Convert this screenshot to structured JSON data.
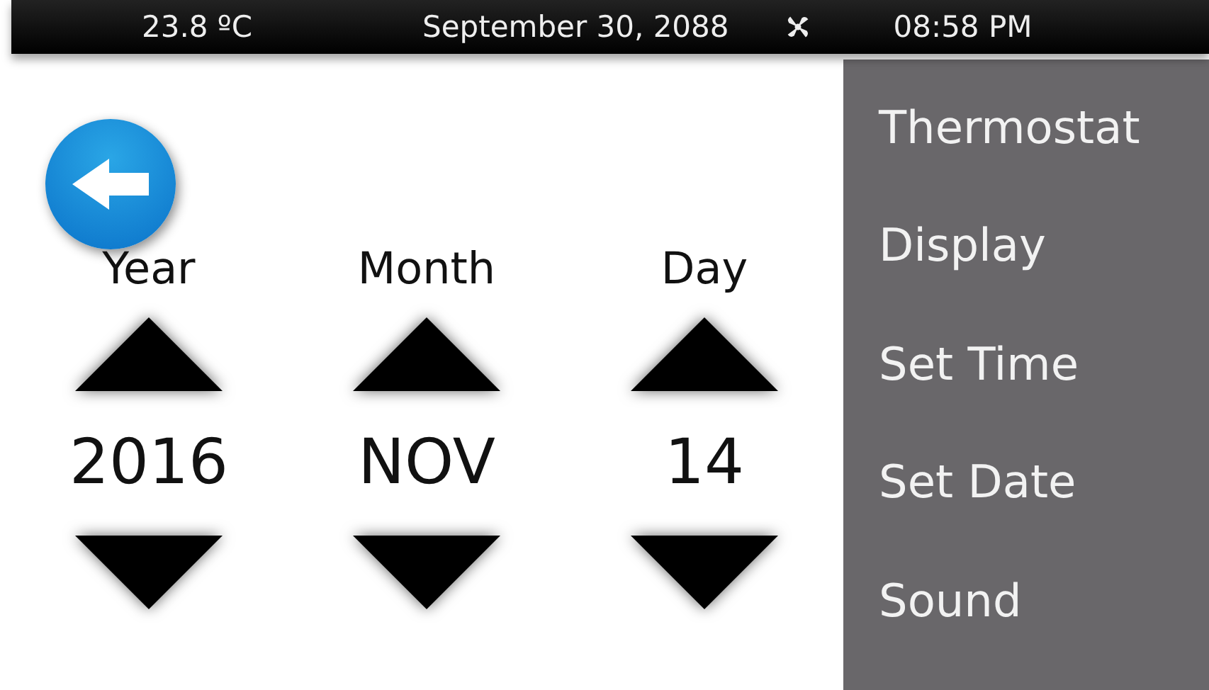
{
  "status_bar": {
    "temperature": "23.8 ºC",
    "date": "September 30, 2088",
    "time": "08:58 PM"
  },
  "pickers": [
    {
      "label": "Year",
      "value": "2016"
    },
    {
      "label": "Month",
      "value": "NOV"
    },
    {
      "label": "Day",
      "value": "14"
    }
  ],
  "menu": {
    "items": [
      {
        "label": "Thermostat"
      },
      {
        "label": "Display"
      },
      {
        "label": "Set Time"
      },
      {
        "label": "Set Date"
      },
      {
        "label": "Sound"
      }
    ]
  }
}
